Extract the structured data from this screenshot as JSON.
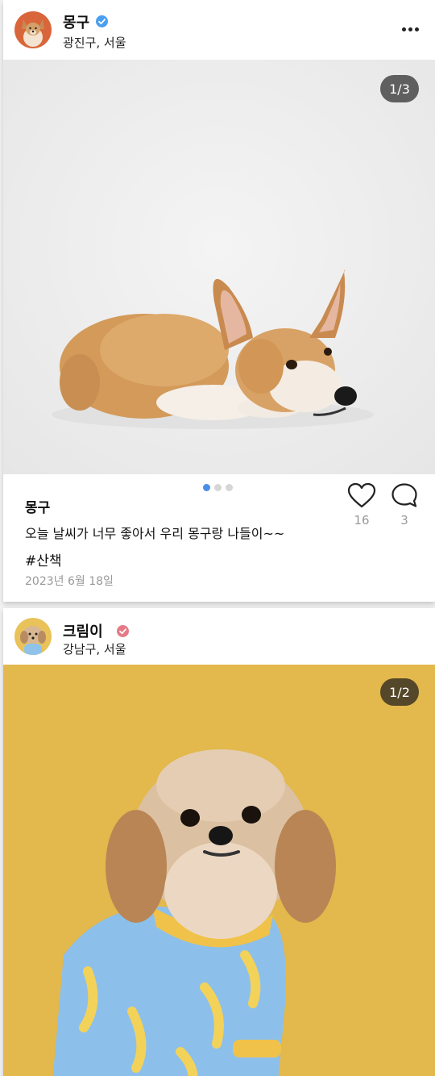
{
  "posts": [
    {
      "username": "몽구",
      "location": "광진구, 서울",
      "verified_color": "#4a9ff0",
      "image_counter": "1/3",
      "image_subject": "corgi lying on white background",
      "caption_user": "몽구",
      "caption": "오늘 날씨가 너무 좋아서 우리 몽구랑 나들이~~",
      "hashtag": "#산책",
      "date": "2023년 6월 18일",
      "likes": "16",
      "comments": "3",
      "carousel": {
        "pages": 3,
        "active": 1
      }
    },
    {
      "username": "크림이",
      "location": "강남구, 서울",
      "verified_color": "#e57a86",
      "image_counter": "1/2",
      "image_subject": "fluffy dog in banana pajamas on yellow background"
    }
  ],
  "icons": {
    "more": "more-icon",
    "like": "heart-icon",
    "comment": "comment-icon"
  },
  "colors": {
    "active_dot": "#4a8ee8",
    "photo2_bg": "#e3b84c",
    "photo1_bg": "#ebebeb"
  }
}
